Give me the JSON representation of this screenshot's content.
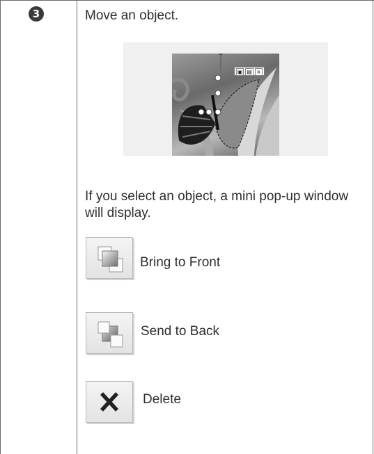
{
  "step": {
    "number": "3",
    "title": "Move an object."
  },
  "explanation": "If you select an object, a mini pop-up window will display.",
  "illustration": {
    "icons": [
      "bring-to-front-icon",
      "send-to-back-icon",
      "delete-icon"
    ],
    "minipop_close_glyph": "×"
  },
  "actions": [
    {
      "icon": "bring-to-front-icon",
      "label": "Bring to Front"
    },
    {
      "icon": "send-to-back-icon",
      "label": "Send to Back"
    },
    {
      "icon": "delete-icon",
      "label": "Delete"
    }
  ],
  "colors": {
    "border": "#6b6b6b",
    "text": "#2e2e2e",
    "illustration_bg": "#f0f0f0",
    "button_bg": "#e8e8e8"
  }
}
